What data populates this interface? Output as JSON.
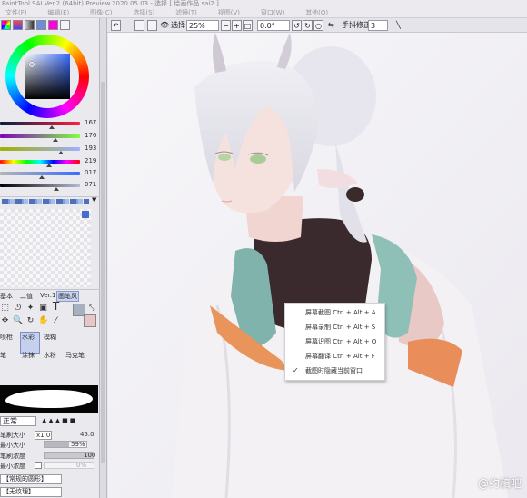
{
  "window": {
    "title": "PaintTool SAI Ver.2 (64bit) Preview.2020.05.03 - 选择 [ 绘画作品.sai2 ]"
  },
  "menu": [
    "文件(F)",
    "编辑(E)",
    "图像(C)",
    "选择(S)",
    "滤镜(T)",
    "视图(V)",
    "窗口(W)",
    "其他(O)"
  ],
  "toolbar": {
    "select_label": "选择",
    "zoom": "25%",
    "angle": "0.0°",
    "stabilizer_label": "手抖修正",
    "stabilizer_value": "3"
  },
  "color_sliders": {
    "rgb": [
      {
        "label": "R",
        "value": "167",
        "level": 0.65
      },
      {
        "label": "G",
        "value": "176",
        "level": 0.69
      },
      {
        "label": "B",
        "value": "193",
        "level": 0.76
      }
    ],
    "hsv": [
      {
        "label": "H",
        "value": "219",
        "level": 0.61
      },
      {
        "label": "S",
        "value": "017",
        "level": 0.52
      },
      {
        "label": "V",
        "value": "071",
        "level": 0.71
      }
    ]
  },
  "tool_tabs": [
    "基本",
    "二值",
    "Ver.1",
    "画笔风"
  ],
  "brushes": [
    {
      "label": "喷枪"
    },
    {
      "label": "水彩"
    },
    {
      "label": "模糊"
    },
    {
      "label": "笔"
    },
    {
      "label": "涂抹"
    },
    {
      "label": "水粉"
    },
    {
      "label": "马克笔"
    }
  ],
  "brush_settings": {
    "mode": "正常",
    "size_label": "笔刷大小",
    "size_multiplier": "x1.0",
    "size_value": "45.0",
    "min_size_label": "最小大小",
    "min_size_value": "59%",
    "min_size_level": 0.59,
    "density_label": "笔刷浓度",
    "density_value": "100",
    "density_level": 1.0,
    "min_density_label": "最小浓度",
    "min_density_value": "0%",
    "min_density_level": 0.0,
    "shape_label": "【常规的圆形】",
    "texture_label": "【无纹理】"
  },
  "context_menu": {
    "items": [
      {
        "label": "屏幕截图 Ctrl + Alt + A",
        "checked": false
      },
      {
        "label": "屏幕录制 Ctrl + Alt + S",
        "checked": false
      },
      {
        "label": "屏幕识图 Ctrl + Alt + O",
        "checked": false
      },
      {
        "label": "屏幕翻译 Ctrl + Alt + F",
        "checked": false
      },
      {
        "label": "截图时隐藏当前窗口",
        "checked": true
      }
    ]
  },
  "watermark": "@约稿吧"
}
